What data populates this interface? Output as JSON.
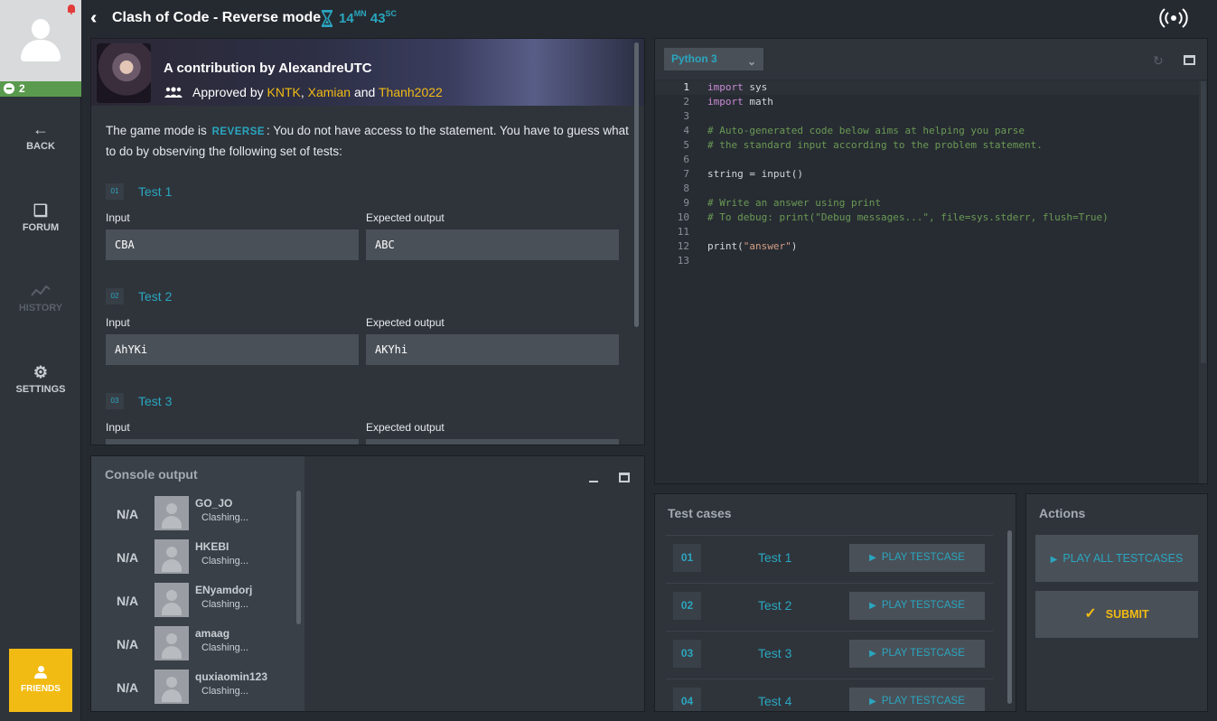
{
  "sidebar": {
    "online_count": "2",
    "back_label": "BACK",
    "forum_label": "FORUM",
    "history_label": "HISTORY",
    "settings_label": "SETTINGS",
    "friends_label": "FRIENDS"
  },
  "header": {
    "title": "Clash of Code - Reverse mode",
    "timer_minutes": "14",
    "timer_minutes_unit": "MN",
    "timer_seconds": "43",
    "timer_seconds_unit": "SC"
  },
  "statement": {
    "contribution_title": "A contribution by AlexandreUTC",
    "approved_prefix": "Approved by",
    "approvers": [
      "KNTK",
      "Xamian",
      "Thanh2022"
    ],
    "approvers_sep": ",",
    "approvers_and": "and",
    "mode_prefix": "The game mode is",
    "mode_name": "REVERSE",
    "mode_suffix": ": You do not have access to the statement. You have to guess what to do by observing the following set of tests:",
    "input_label": "Input",
    "expected_label": "Expected output",
    "tests": [
      {
        "num": "01",
        "name": "Test 1",
        "input": "CBA",
        "output": "ABC"
      },
      {
        "num": "02",
        "name": "Test 2",
        "input": "AhYKi",
        "output": "AKYhi"
      },
      {
        "num": "03",
        "name": "Test 3",
        "input": "",
        "output": ""
      }
    ]
  },
  "console": {
    "title": "Console output",
    "players": [
      {
        "score": "N/A",
        "name": "GO_JO",
        "status": "Clashing..."
      },
      {
        "score": "N/A",
        "name": "HKEBI",
        "status": "Clashing..."
      },
      {
        "score": "N/A",
        "name": "ENyamdorj",
        "status": "Clashing..."
      },
      {
        "score": "N/A",
        "name": "amaag",
        "status": "Clashing..."
      },
      {
        "score": "N/A",
        "name": "quxiaomin123",
        "status": "Clashing..."
      }
    ]
  },
  "editor": {
    "language": "Python 3",
    "lines": [
      {
        "n": "1",
        "kw": "import",
        "rest": " sys",
        "type": "import"
      },
      {
        "n": "2",
        "kw": "import",
        "rest": " math",
        "type": "import"
      },
      {
        "n": "3",
        "text": "",
        "type": "plain"
      },
      {
        "n": "4",
        "text": "# Auto-generated code below aims at helping you parse",
        "type": "comment"
      },
      {
        "n": "5",
        "text": "# the standard input according to the problem statement.",
        "type": "comment"
      },
      {
        "n": "6",
        "text": "",
        "type": "plain"
      },
      {
        "n": "7",
        "text": "string = input()",
        "type": "plain"
      },
      {
        "n": "8",
        "text": "",
        "type": "plain"
      },
      {
        "n": "9",
        "text": "# Write an answer using print",
        "type": "comment"
      },
      {
        "n": "10",
        "text": "# To debug: print(\"Debug messages...\", file=sys.stderr, flush=True)",
        "type": "comment"
      },
      {
        "n": "11",
        "text": "",
        "type": "plain"
      },
      {
        "n": "12",
        "pre": "print(",
        "str": "\"answer\"",
        "post": ")",
        "type": "print"
      },
      {
        "n": "13",
        "text": "",
        "type": "plain"
      }
    ]
  },
  "testcases": {
    "title": "Test cases",
    "play_label": "PLAY TESTCASE",
    "items": [
      {
        "num": "01",
        "name": "Test 1"
      },
      {
        "num": "02",
        "name": "Test 2"
      },
      {
        "num": "03",
        "name": "Test 3"
      },
      {
        "num": "04",
        "name": "Test 4"
      }
    ]
  },
  "actions": {
    "title": "Actions",
    "play_all_label": "PLAY ALL TESTCASES",
    "submit_label": "SUBMIT"
  },
  "colors": {
    "accent": "#2aa6bf",
    "highlight": "#f2bb13",
    "background": "#252a30",
    "panel": "#2f343b",
    "online": "#5a9a4e",
    "notification": "#e23b3b"
  }
}
